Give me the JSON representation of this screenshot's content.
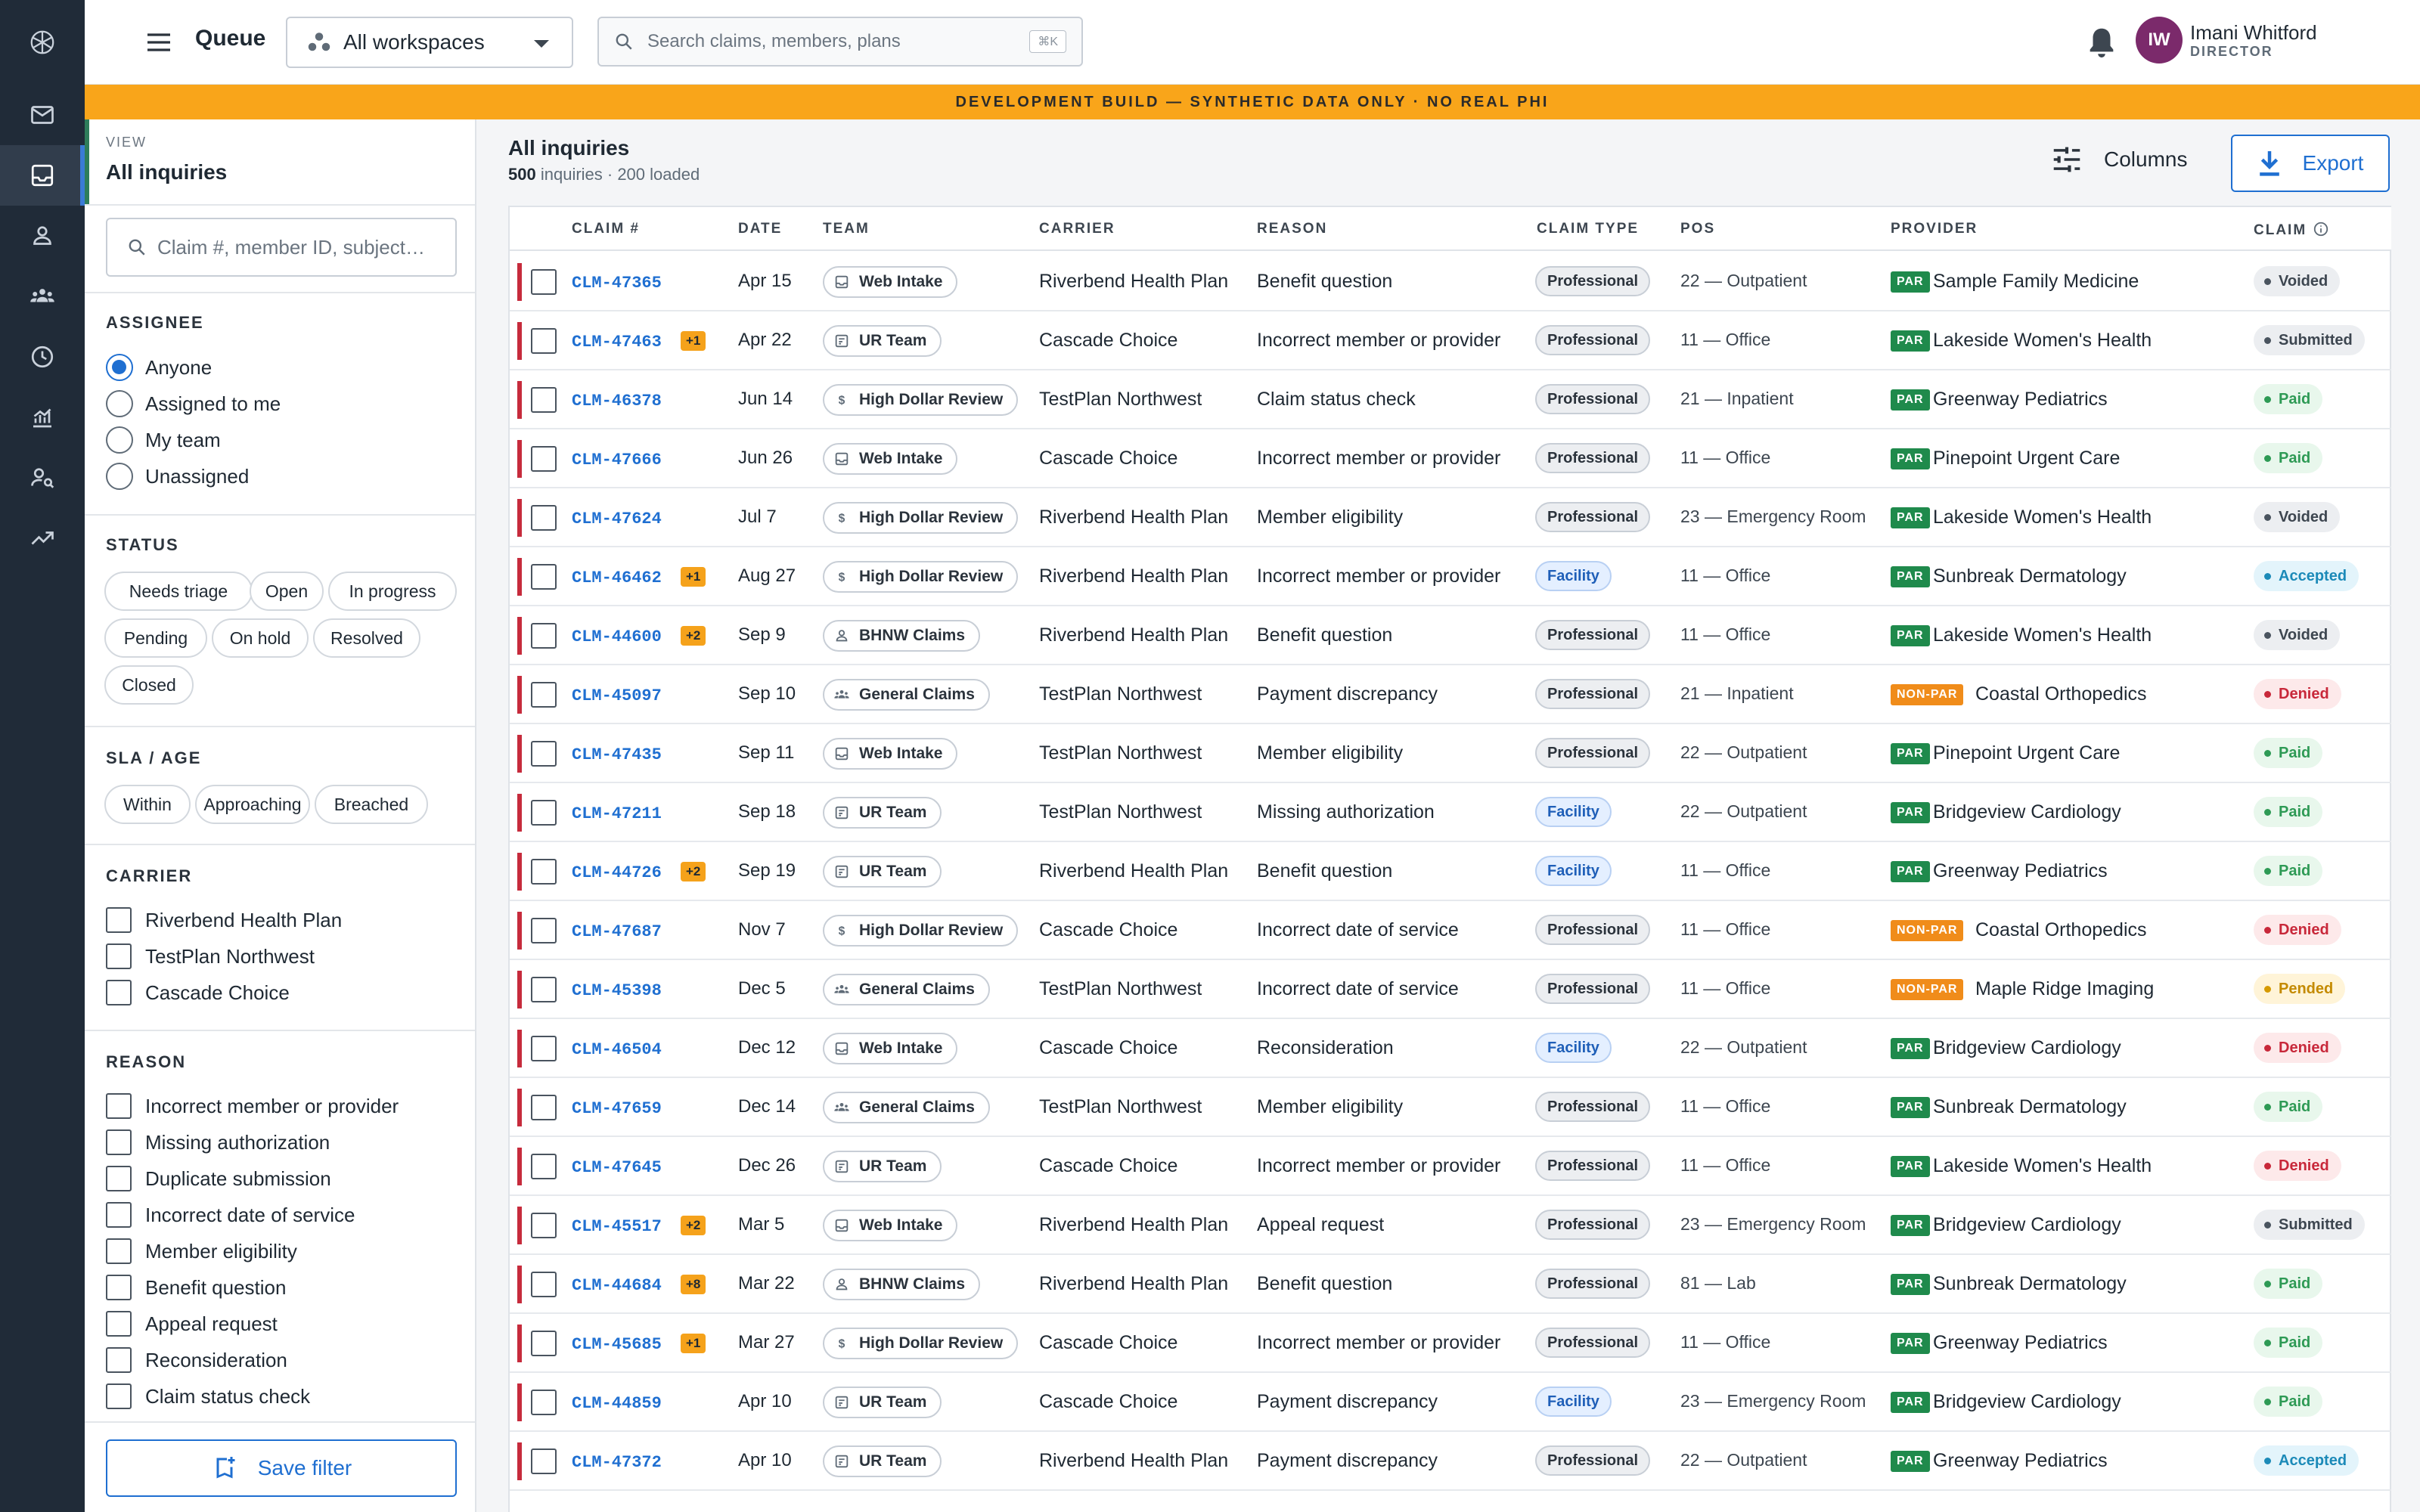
{
  "app": {
    "queue_title": "Queue"
  },
  "workspace": {
    "label": "All workspaces"
  },
  "search": {
    "placeholder": "Search claims, members, plans",
    "shortcut": "⌘K"
  },
  "user": {
    "initials": "IW",
    "name": "Imani Whitford",
    "role": "DIRECTOR"
  },
  "banner": "DEVELOPMENT BUILD — SYNTHETIC DATA ONLY · NO REAL PHI",
  "rail": [
    "logo-icon",
    "mail-icon",
    "inbox-icon",
    "person-icon",
    "group-icon",
    "clock-icon",
    "analytics-icon",
    "user-search-icon",
    "trending-icon"
  ],
  "filters": {
    "view_label": "VIEW",
    "view_name": "All inquiries",
    "search_placeholder": "Claim #, member ID, subject…",
    "assignee": {
      "title": "ASSIGNEE",
      "options": [
        "Anyone",
        "Assigned to me",
        "My team",
        "Unassigned"
      ],
      "selected": "Anyone"
    },
    "status": {
      "title": "STATUS",
      "options": [
        "Needs triage",
        "Open",
        "In progress",
        "Pending",
        "On hold",
        "Resolved",
        "Closed"
      ]
    },
    "sla": {
      "title": "SLA / AGE",
      "options": [
        "Within",
        "Approaching",
        "Breached"
      ]
    },
    "carrier": {
      "title": "CARRIER",
      "options": [
        "Riverbend Health Plan",
        "TestPlan Northwest",
        "Cascade Choice"
      ]
    },
    "reason": {
      "title": "REASON",
      "options": [
        "Incorrect member or provider",
        "Missing authorization",
        "Duplicate submission",
        "Incorrect date of service",
        "Member eligibility",
        "Benefit question",
        "Appeal request",
        "Reconsideration",
        "Claim status check"
      ]
    },
    "save_label": "Save filter"
  },
  "list": {
    "title": "All inquiries",
    "count": "500",
    "count_suffix": "inquiries · 200 loaded",
    "columns_label": "Columns",
    "export_label": "Export"
  },
  "table": {
    "headers": {
      "claim": "CLAIM #",
      "date": "DATE",
      "team": "TEAM",
      "carrier": "CARRIER",
      "reason": "REASON",
      "claim_type": "CLAIM TYPE",
      "pos": "POS",
      "provider": "PROVIDER",
      "status": "CLAIM"
    },
    "rows": [
      {
        "claim": "CLM-47365",
        "badge": "",
        "date": "Apr 15",
        "team": "Web Intake",
        "team_icon": "inbox-icon",
        "carrier": "Riverbend Health Plan",
        "reason": "Benefit question",
        "type": "Professional",
        "pos": "22 — Outpatient",
        "par": "PAR",
        "provider": "Sample Family Medicine",
        "status": "Voided"
      },
      {
        "claim": "CLM-47463",
        "badge": "+1",
        "date": "Apr 22",
        "team": "UR Team",
        "team_icon": "review-icon",
        "carrier": "Cascade Choice",
        "reason": "Incorrect member or provider",
        "type": "Professional",
        "pos": "11 — Office",
        "par": "PAR",
        "provider": "Lakeside Women's Health",
        "status": "Submitted"
      },
      {
        "claim": "CLM-46378",
        "badge": "",
        "date": "Jun 14",
        "team": "High Dollar Review",
        "team_icon": "dollar-icon",
        "carrier": "TestPlan Northwest",
        "reason": "Claim status check",
        "type": "Professional",
        "pos": "21 — Inpatient",
        "par": "PAR",
        "provider": "Greenway Pediatrics",
        "status": "Paid"
      },
      {
        "claim": "CLM-47666",
        "badge": "",
        "date": "Jun 26",
        "team": "Web Intake",
        "team_icon": "inbox-icon",
        "carrier": "Cascade Choice",
        "reason": "Incorrect member or provider",
        "type": "Professional",
        "pos": "11 — Office",
        "par": "PAR",
        "provider": "Pinepoint Urgent Care",
        "status": "Paid"
      },
      {
        "claim": "CLM-47624",
        "badge": "",
        "date": "Jul 7",
        "team": "High Dollar Review",
        "team_icon": "dollar-icon",
        "carrier": "Riverbend Health Plan",
        "reason": "Member eligibility",
        "type": "Professional",
        "pos": "23 — Emergency Room",
        "par": "PAR",
        "provider": "Lakeside Women's Health",
        "status": "Voided"
      },
      {
        "claim": "CLM-46462",
        "badge": "+1",
        "date": "Aug 27",
        "team": "High Dollar Review",
        "team_icon": "dollar-icon",
        "carrier": "Riverbend Health Plan",
        "reason": "Incorrect member or provider",
        "type": "Facility",
        "pos": "11 — Office",
        "par": "PAR",
        "provider": "Sunbreak Dermatology",
        "status": "Accepted"
      },
      {
        "claim": "CLM-44600",
        "badge": "+2",
        "date": "Sep 9",
        "team": "BHNW Claims",
        "team_icon": "person-icon",
        "carrier": "Riverbend Health Plan",
        "reason": "Benefit question",
        "type": "Professional",
        "pos": "11 — Office",
        "par": "PAR",
        "provider": "Lakeside Women's Health",
        "status": "Voided"
      },
      {
        "claim": "CLM-45097",
        "badge": "",
        "date": "Sep 10",
        "team": "General Claims",
        "team_icon": "group-icon",
        "carrier": "TestPlan Northwest",
        "reason": "Payment discrepancy",
        "type": "Professional",
        "pos": "21 — Inpatient",
        "par": "NON-PAR",
        "provider": "Coastal Orthopedics",
        "status": "Denied"
      },
      {
        "claim": "CLM-47435",
        "badge": "",
        "date": "Sep 11",
        "team": "Web Intake",
        "team_icon": "inbox-icon",
        "carrier": "TestPlan Northwest",
        "reason": "Member eligibility",
        "type": "Professional",
        "pos": "22 — Outpatient",
        "par": "PAR",
        "provider": "Pinepoint Urgent Care",
        "status": "Paid"
      },
      {
        "claim": "CLM-47211",
        "badge": "",
        "date": "Sep 18",
        "team": "UR Team",
        "team_icon": "review-icon",
        "carrier": "TestPlan Northwest",
        "reason": "Missing authorization",
        "type": "Facility",
        "pos": "22 — Outpatient",
        "par": "PAR",
        "provider": "Bridgeview Cardiology",
        "status": "Paid"
      },
      {
        "claim": "CLM-44726",
        "badge": "+2",
        "date": "Sep 19",
        "team": "UR Team",
        "team_icon": "review-icon",
        "carrier": "Riverbend Health Plan",
        "reason": "Benefit question",
        "type": "Facility",
        "pos": "11 — Office",
        "par": "PAR",
        "provider": "Greenway Pediatrics",
        "status": "Paid"
      },
      {
        "claim": "CLM-47687",
        "badge": "",
        "date": "Nov 7",
        "team": "High Dollar Review",
        "team_icon": "dollar-icon",
        "carrier": "Cascade Choice",
        "reason": "Incorrect date of service",
        "type": "Professional",
        "pos": "11 — Office",
        "par": "NON-PAR",
        "provider": "Coastal Orthopedics",
        "status": "Denied"
      },
      {
        "claim": "CLM-45398",
        "badge": "",
        "date": "Dec 5",
        "team": "General Claims",
        "team_icon": "group-icon",
        "carrier": "TestPlan Northwest",
        "reason": "Incorrect date of service",
        "type": "Professional",
        "pos": "11 — Office",
        "par": "NON-PAR",
        "provider": "Maple Ridge Imaging",
        "status": "Pended"
      },
      {
        "claim": "CLM-46504",
        "badge": "",
        "date": "Dec 12",
        "team": "Web Intake",
        "team_icon": "inbox-icon",
        "carrier": "Cascade Choice",
        "reason": "Reconsideration",
        "type": "Facility",
        "pos": "22 — Outpatient",
        "par": "PAR",
        "provider": "Bridgeview Cardiology",
        "status": "Denied"
      },
      {
        "claim": "CLM-47659",
        "badge": "",
        "date": "Dec 14",
        "team": "General Claims",
        "team_icon": "group-icon",
        "carrier": "TestPlan Northwest",
        "reason": "Member eligibility",
        "type": "Professional",
        "pos": "11 — Office",
        "par": "PAR",
        "provider": "Sunbreak Dermatology",
        "status": "Paid"
      },
      {
        "claim": "CLM-47645",
        "badge": "",
        "date": "Dec 26",
        "team": "UR Team",
        "team_icon": "review-icon",
        "carrier": "Cascade Choice",
        "reason": "Incorrect member or provider",
        "type": "Professional",
        "pos": "11 — Office",
        "par": "PAR",
        "provider": "Lakeside Women's Health",
        "status": "Denied"
      },
      {
        "claim": "CLM-45517",
        "badge": "+2",
        "date": "Mar 5",
        "team": "Web Intake",
        "team_icon": "inbox-icon",
        "carrier": "Riverbend Health Plan",
        "reason": "Appeal request",
        "type": "Professional",
        "pos": "23 — Emergency Room",
        "par": "PAR",
        "provider": "Bridgeview Cardiology",
        "status": "Submitted"
      },
      {
        "claim": "CLM-44684",
        "badge": "+8",
        "date": "Mar 22",
        "team": "BHNW Claims",
        "team_icon": "person-icon",
        "carrier": "Riverbend Health Plan",
        "reason": "Benefit question",
        "type": "Professional",
        "pos": "81 — Lab",
        "par": "PAR",
        "provider": "Sunbreak Dermatology",
        "status": "Paid"
      },
      {
        "claim": "CLM-45685",
        "badge": "+1",
        "date": "Mar 27",
        "team": "High Dollar Review",
        "team_icon": "dollar-icon",
        "carrier": "Cascade Choice",
        "reason": "Incorrect member or provider",
        "type": "Professional",
        "pos": "11 — Office",
        "par": "PAR",
        "provider": "Greenway Pediatrics",
        "status": "Paid"
      },
      {
        "claim": "CLM-44859",
        "badge": "",
        "date": "Apr 10",
        "team": "UR Team",
        "team_icon": "review-icon",
        "carrier": "Cascade Choice",
        "reason": "Payment discrepancy",
        "type": "Facility",
        "pos": "23 — Emergency Room",
        "par": "PAR",
        "provider": "Bridgeview Cardiology",
        "status": "Paid"
      },
      {
        "claim": "CLM-47372",
        "badge": "",
        "date": "Apr 10",
        "team": "UR Team",
        "team_icon": "review-icon",
        "carrier": "Riverbend Health Plan",
        "reason": "Payment discrepancy",
        "type": "Professional",
        "pos": "22 — Outpatient",
        "par": "PAR",
        "provider": "Greenway Pediatrics",
        "status": "Accepted"
      }
    ]
  },
  "colors": {
    "rail": "#202b38",
    "accent": "#1f6fd1",
    "banner": "#f9a51a",
    "flag": "#c62b3c",
    "par": "#1f8a4c",
    "non_par": "#f08c1a"
  }
}
